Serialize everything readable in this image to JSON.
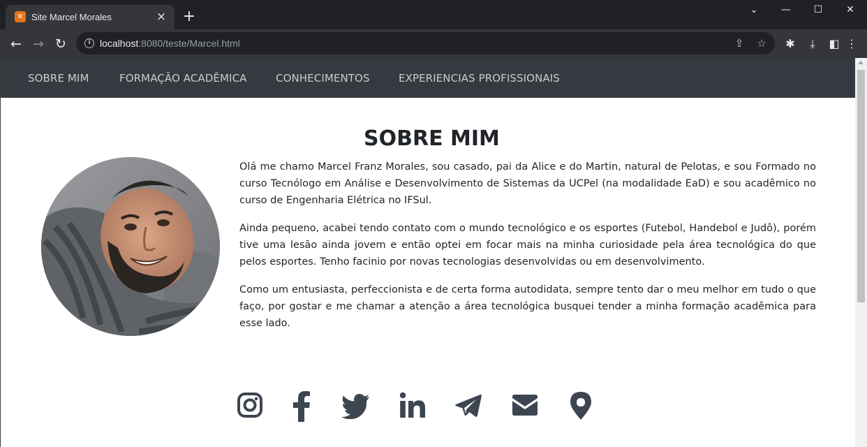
{
  "browser": {
    "tab_title": "Site Marcel Morales",
    "tab_favicon": "xampp-favicon",
    "close_tab": "×",
    "new_tab": "+",
    "url_host": "localhost",
    "url_rest": ":8080/teste/Marcel.html"
  },
  "site": {
    "nav": [
      {
        "label": "SOBRE MIM"
      },
      {
        "label": "FORMAÇÃO ACADÊMICA"
      },
      {
        "label": "CONHECIMENTOS"
      },
      {
        "label": "EXPERIENCIAS PROFISSIONAIS"
      }
    ],
    "section_title": "SOBRE MIM",
    "paragraphs": [
      "Olá me chamo Marcel Franz Morales, sou casado, pai da Alice e do Martin, natural de Pelotas, e sou Formado no curso Tecnólogo em Análise e Desenvolvimento de Sistemas da UCPel (na modalidade EaD) e sou acadêmico no curso de Engenharia Elétrica no IFSul.",
      "Ainda pequeno, acabei tendo contato com o mundo tecnológico e os esportes (Futebol, Handebol e Judô), porém tive uma lesão ainda jovem e então optei em focar mais na minha curiosidade pela área tecnológica do que pelos esportes. Tenho facinio por novas tecnologias desenvolvidas ou em desenvolvimento.",
      "Como um entusiasta, perfeccionista e de certa forma autodidata, sempre tento dar o meu melhor em tudo o que faço, por gostar e me chamar a atenção a área tecnológica busquei tender a minha formação acadêmica para esse lado."
    ],
    "social_icons": [
      "instagram-icon",
      "facebook-icon",
      "twitter-icon",
      "linkedin-icon",
      "telegram-icon",
      "email-icon",
      "location-icon"
    ],
    "colors": {
      "navbar_bg": "#343a40",
      "nav_text": "#c9cccf",
      "icon_color": "#3d4550",
      "text_color": "#212529"
    }
  }
}
